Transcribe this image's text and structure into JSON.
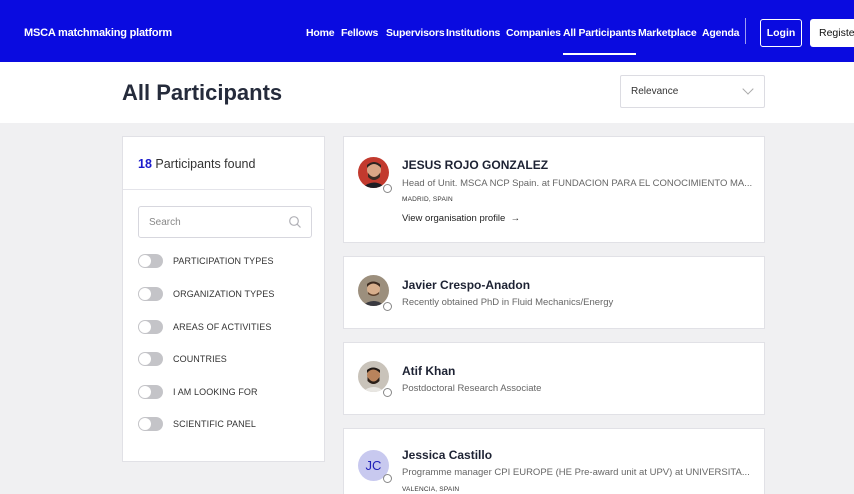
{
  "nav": {
    "brand": "MSCA matchmaking platform",
    "items": [
      "Home",
      "Fellows",
      "Supervisors",
      "Institutions",
      "Companies",
      "All Participants",
      "Marketplace",
      "Agenda"
    ],
    "active": "All Participants",
    "login": "Login",
    "register": "Register"
  },
  "header": {
    "title": "All Participants",
    "sort": "Relevance"
  },
  "filters": {
    "count": "18",
    "found_label": "Participants found",
    "search_placeholder": "Search",
    "toggles": [
      "PARTICIPATION TYPES",
      "ORGANIZATION TYPES",
      "AREAS OF ACTIVITIES",
      "COUNTRIES",
      "I AM LOOKING FOR",
      "SCIENTIFIC PANEL"
    ]
  },
  "participants": [
    {
      "name": "JESUS ROJO GONZALEZ",
      "role": "Head of Unit. MSCA NCP Spain. at FUNDACION PARA EL CONOCIMIENTO MA...",
      "location": "MADRID, SPAIN",
      "link": "View organisation profile"
    },
    {
      "name": "Javier Crespo-Anadon",
      "role": "Recently obtained PhD in Fluid Mechanics/Energy"
    },
    {
      "name": "Atif Khan",
      "role": "Postdoctoral Research Associate"
    },
    {
      "name": "Jessica Castillo",
      "initials": "JC",
      "role": "Programme manager CPI EUROPE (HE Pre-award unit at UPV) at UNIVERSITA...",
      "location": "VALENCIA, SPAIN"
    }
  ],
  "colors": {
    "brand_blue": "#0a0be0",
    "count_blue": "#1a1acc",
    "initials_bg": "#c8c9ef"
  }
}
